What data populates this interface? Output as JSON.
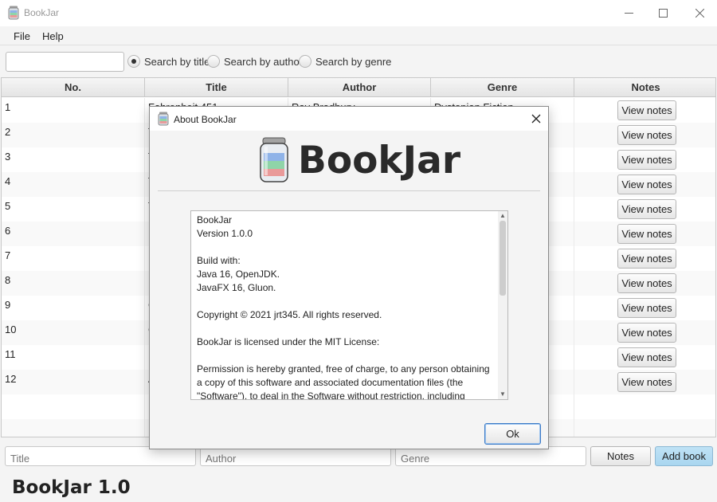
{
  "window": {
    "title": "BookJar"
  },
  "menu": {
    "items": [
      "File",
      "Help"
    ]
  },
  "search": {
    "value": "",
    "options": [
      {
        "label": "Search by title",
        "checked": true
      },
      {
        "label": "Search by author",
        "checked": false
      },
      {
        "label": "Search by genre",
        "checked": false
      }
    ]
  },
  "table": {
    "columns": [
      "No.",
      "Title",
      "Author",
      "Genre",
      "Notes"
    ],
    "rows": [
      {
        "no": "1",
        "title": "Fahrenheit 451",
        "author": "Ray Bradbury",
        "genre": "Dystopian Fiction"
      },
      {
        "no": "2",
        "title": "T",
        "author": "",
        "genre": ""
      },
      {
        "no": "3",
        "title": "T",
        "author": "",
        "genre": ""
      },
      {
        "no": "4",
        "title": "T",
        "author": "",
        "genre": ""
      },
      {
        "no": "5",
        "title": "T",
        "author": "",
        "genre": ""
      },
      {
        "no": "6",
        "title": "I",
        "author": "",
        "genre": ""
      },
      {
        "no": "7",
        "title": "D",
        "author": "",
        "genre": ""
      },
      {
        "no": "8",
        "title": "I",
        "author": "",
        "genre": ""
      },
      {
        "no": "9",
        "title": "C",
        "author": "",
        "genre": ""
      },
      {
        "no": "10",
        "title": "C",
        "author": "",
        "genre": ""
      },
      {
        "no": "11",
        "title": "E",
        "author": "",
        "genre": ""
      },
      {
        "no": "12",
        "title": "A",
        "author": "",
        "genre": ""
      }
    ],
    "notes_button_label": "View notes"
  },
  "add_form": {
    "title_placeholder": "Title",
    "author_placeholder": "Author",
    "genre_placeholder": "Genre",
    "notes_label": "Notes",
    "add_label": "Add book"
  },
  "footer": {
    "version_label": "BookJar 1.0"
  },
  "dialog": {
    "title": "About BookJar",
    "logo_text": "BookJar",
    "about_text": "BookJar\nVersion 1.0.0\n\nBuild with:\nJava 16, OpenJDK.\nJavaFX 16, Gluon.\n\nCopyright © 2021 jrt345. All rights reserved.\n\nBookJar is licensed under the MIT License:\n\nPermission is hereby granted, free of charge, to any person obtaining a copy of this software and associated documentation files (the \"Software\"), to deal in the Software without restriction, including",
    "ok_label": "Ok"
  },
  "colors": {
    "accent": "#3d7bc7",
    "primary_button": "#a9d6f0"
  },
  "icons": [
    "jar-icon",
    "minimize-icon",
    "maximize-icon",
    "close-icon"
  ]
}
